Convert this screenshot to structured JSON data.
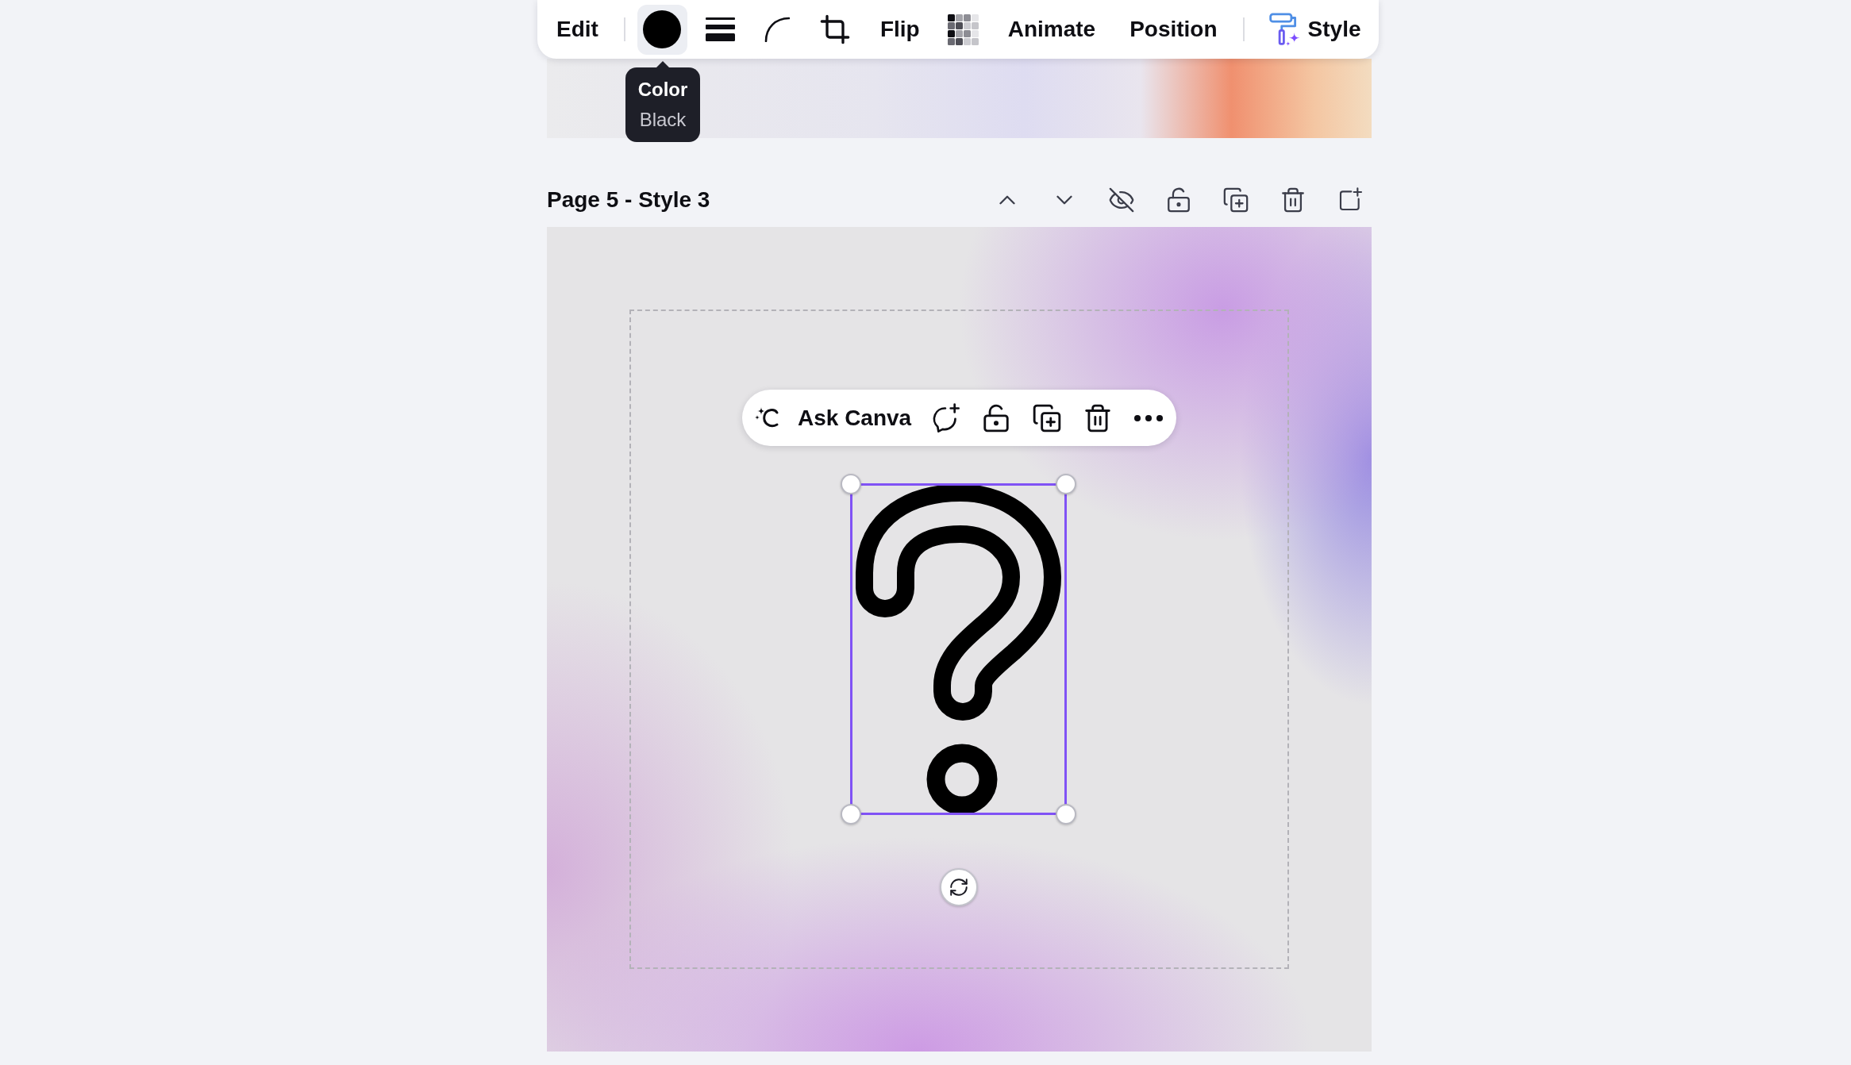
{
  "toolbar": {
    "edit": "Edit",
    "color_swatch": {
      "color": "#000000",
      "hovered": true
    },
    "flip": "Flip",
    "animate": "Animate",
    "position": "Position",
    "style": "Style"
  },
  "tooltip": {
    "title": "Color",
    "value": "Black"
  },
  "page_header": {
    "title": "Page 5 - Style 3"
  },
  "element_toolbar": {
    "ask_label": "Ask Canva"
  },
  "canvas": {
    "element_selected": true
  }
}
